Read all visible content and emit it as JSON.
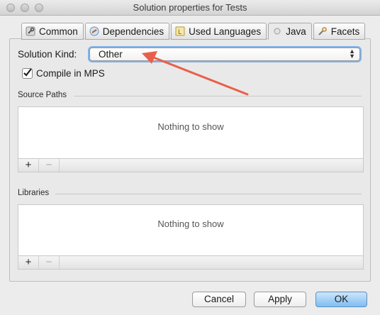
{
  "window": {
    "title": "Solution properties for Tests"
  },
  "tabs": [
    {
      "label": "Common",
      "icon": "wrench-icon",
      "active": false
    },
    {
      "label": "Dependencies",
      "icon": "dependencies-icon",
      "active": false
    },
    {
      "label": "Used Languages",
      "icon": "language-icon",
      "active": false
    },
    {
      "label": "Java",
      "icon": "radio-dot-icon",
      "active": true
    },
    {
      "label": "Facets",
      "icon": "facets-icon",
      "active": false
    }
  ],
  "solution_kind": {
    "label": "Solution Kind:",
    "value": "Other"
  },
  "compile_in_mps": {
    "label": "Compile in MPS",
    "checked": true
  },
  "source_paths": {
    "title": "Source Paths",
    "empty_text": "Nothing to show",
    "add_label": "+",
    "remove_label": "−"
  },
  "libraries": {
    "title": "Libraries",
    "empty_text": "Nothing to show",
    "add_label": "+",
    "remove_label": "−"
  },
  "buttons": {
    "cancel": "Cancel",
    "apply": "Apply",
    "ok": "OK"
  },
  "colors": {
    "annotation_arrow": "#e8604c",
    "focus_ring": "#7fb1ea",
    "default_button": "#7fbdf1"
  }
}
